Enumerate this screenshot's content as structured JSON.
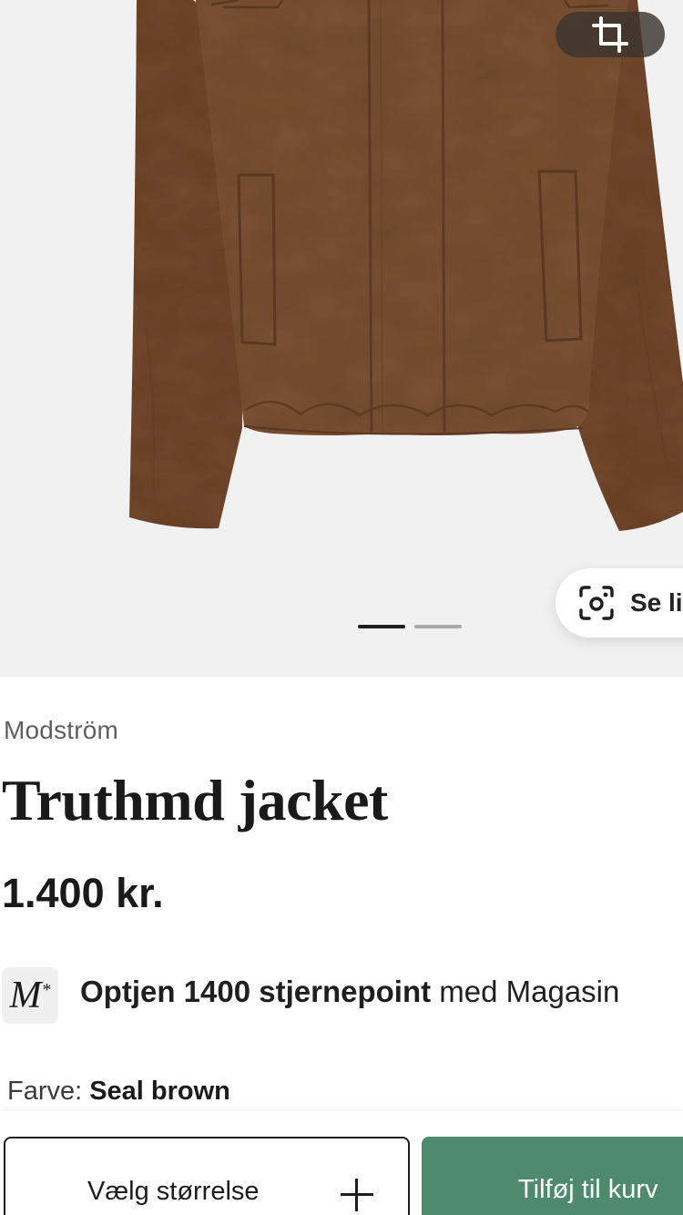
{
  "gallery": {
    "crop_icon": "crop-icon",
    "lens_icon": "visual-search-icon",
    "lens_label": "Se li",
    "slide_count": 2,
    "active_slide": 1
  },
  "product": {
    "brand": "Modström",
    "title": "Truthmd jacket",
    "price": "1.400 kr."
  },
  "loyalty": {
    "badge": "M",
    "badge_star": "*",
    "bold_text": "Optjen 1400 stjernepoint",
    "rest_text": " med Magasin"
  },
  "color": {
    "label": "Farve:",
    "value": "Seal brown"
  },
  "actions": {
    "size_label": "Vælg størrelse",
    "cart_label": "Tilføj til kurv"
  },
  "colors": {
    "jacket": "#7a4f33",
    "cart_button": "#4d8a6e",
    "background": "#f1f1f1"
  }
}
